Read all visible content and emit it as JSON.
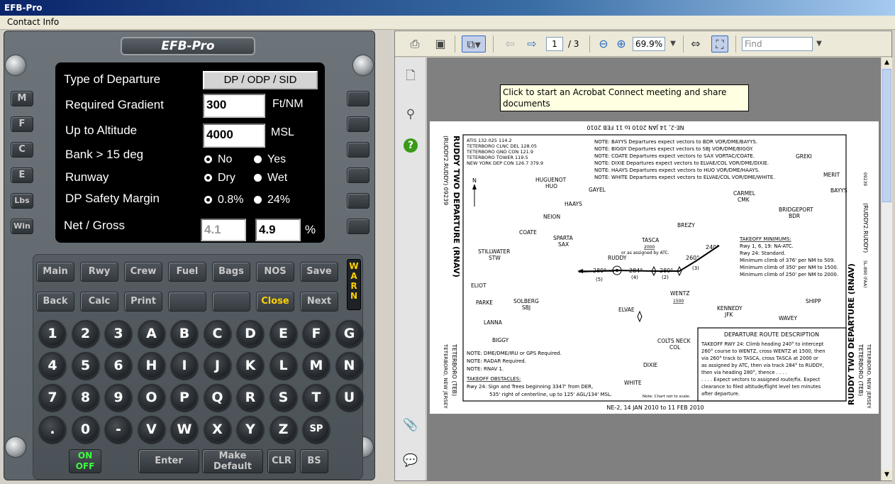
{
  "window": {
    "title": "EFB-Pro"
  },
  "menu": {
    "contact": "Contact Info"
  },
  "efb": {
    "logo": "EFB-Pro",
    "left_keys": [
      "M",
      "F",
      "C",
      "E",
      "Lbs",
      "Win"
    ],
    "type_label": "Type of Departure",
    "type_value": "DP / ODP / SID",
    "gradient_label": "Required Gradient",
    "gradient_value": "300",
    "gradient_unit": "Ft/NM",
    "altitude_label": "Up to Altitude",
    "altitude_value": "4000",
    "altitude_unit": "MSL",
    "bank_label": "Bank > 15 deg",
    "bank_no": "No",
    "bank_yes": "Yes",
    "runway_label": "Runway",
    "runway_dry": "Dry",
    "runway_wet": "Wet",
    "margin_label": "DP Safety Margin",
    "margin_a": "0.8%",
    "margin_b": "24%",
    "net_label": "Net  /  Gross",
    "net_value": "4.1",
    "gross_value": "4.9",
    "pct": "%",
    "fkeys_row1": [
      "Main",
      "Rwy",
      "Crew",
      "Fuel",
      "Bags",
      "NOS",
      "Save"
    ],
    "fkeys_row2": [
      "Back",
      "Calc",
      "Print",
      "",
      "",
      "Close",
      "Next"
    ],
    "warn": "W A R N",
    "keys": [
      [
        "1",
        "2",
        "3",
        "A",
        "B",
        "C",
        "D",
        "E",
        "F",
        "G"
      ],
      [
        "4",
        "5",
        "6",
        "H",
        "I",
        "J",
        "K",
        "L",
        "M",
        "N"
      ],
      [
        "7",
        "8",
        "9",
        "O",
        "P",
        "Q",
        "R",
        "S",
        "T",
        "U"
      ],
      [
        ".",
        "0",
        "-",
        "V",
        "W",
        "X",
        "Y",
        "Z",
        "SP"
      ]
    ],
    "on_off": "ON OFF",
    "enter": "Enter",
    "make_default": "Make Default",
    "clr": "CLR",
    "bs": "BS"
  },
  "pdf": {
    "page": "1",
    "total": "/ 3",
    "zoom": "69.9%",
    "find": "Find",
    "tooltip": "Click to start an Acrobat Connect meeting and share documents",
    "chart": {
      "header_top": "NE-2, 14 JAN 2010 to 11 FEB 2010",
      "footer": "NE-2, 14 JAN 2010 to 11 FEB 2010",
      "title_left": "RUDDY TWO DEPARTURE (RNAV)",
      "title_left2": "(RUDDY2.RUDDY) 09239",
      "title_right": "RUDDY TWO DEPARTURE (RNAV)",
      "title_right2": "(RUDDY2.RUDDY)",
      "airport_left": "TETERBORO, NEW JERSEY",
      "airport_left2": "TETERBORO (TEB)",
      "airport_right": "TETERBORO (TEB)",
      "airport_right2": "TETERBORO, NEW JERSEY",
      "freqs": [
        "ATIS 132.025 114.2",
        "TETERBORO CLNC DEL 128.05",
        "TETERBORO GND CON 121.9",
        "TETERBORO TOWER 119.5",
        "NEW YORK DEP CON 126.7 379.9"
      ],
      "notes": [
        "NOTE: BAYYS Departures expect vectors to BDR VOR/DME/BAYYS.",
        "NOTE: BIGGY Departures expect vectors to SBJ VOR/DME/BIGGY.",
        "NOTE: COATE Departures expect vectors to SAX VORTAC/COATE.",
        "NOTE: DIXIE Departures expect vectors to ELVAE/COL VOR/DME/DIXIE.",
        "NOTE: HAAYS Departures expect vectors to HUO VOR/DME/HAAYS.",
        "NOTE: WHITE Departures expect vectors to ELVAE/COL VOR/DME/WHITE."
      ],
      "fixes": [
        "GREKI",
        "MERIT",
        "BAYYS",
        "CARMEL",
        "CMK",
        "BRIDGEPORT",
        "BDR",
        "HUGUENOT",
        "HUO",
        "GAYEL",
        "HAAYS",
        "NEION",
        "COATE",
        "SPARTA",
        "SAX",
        "BREZY",
        "STILLWATER",
        "STW",
        "TASCA",
        "RUDDY",
        "WENTZ",
        "ELIOT",
        "PARKE",
        "SOLBERG",
        "SBJ",
        "ELVAE",
        "KENNEDY",
        "JFK",
        "SHIPP",
        "WAVEY",
        "LANNA",
        "BIGGY",
        "COLTS NECK",
        "COL",
        "DIXIE",
        "WHITE"
      ],
      "tasca_alt": "2000",
      "tasca_note": "or as assigned by ATC.",
      "wentz_alt": "1500",
      "headings": [
        "280°",
        "284°",
        "280°",
        "260°",
        "240°"
      ],
      "legs": [
        "(5)",
        "(4)",
        "(2)",
        "(3)"
      ],
      "minimums_title": "TAKEOFF MINIMUMS:",
      "minimums": [
        "Rwy 1, 6, 19:  NA-ATC.",
        "Rwy 24: Standard.",
        "Minimum climb of 376' per NM to 509.",
        "Minimum climb of 350' per NM to 1500.",
        "Minimum climb of 250' per NM to 2000."
      ],
      "bottom_notes": [
        "NOTE:  DME/DME/IRU or GPS Required.",
        "NOTE:  RADAR Required.",
        "NOTE:  RNAV 1."
      ],
      "obstacles_title": "TAKEOFF OBSTACLES:",
      "obstacles": [
        "Rwy 24: Sign and Trees beginning 3347' from DER,",
        "535' right of centerline, up to 125' AGL/134' MSL."
      ],
      "scale_note": "Note: Chart not to scale.",
      "route_title": "DEPARTURE ROUTE DESCRIPTION",
      "route_lines": [
        "TAKEOFF RWY 24: Climb heading 240° to intercept",
        "260° course to WENTZ, cross WENTZ at 1500, then",
        "via 260° track to TASCA, cross TASCA at 2000 or",
        "as assigned by ATC, then via track 284° to RUDDY,",
        "then via heading 280°, thence . . . .",
        ". . . . Expect vectors to assigned route/fix. Expect",
        "clearance to filed altitude/flight level ten minutes",
        "after departure."
      ],
      "side_code": "SL-890 (FAA)",
      "side_code2": "09239"
    }
  }
}
